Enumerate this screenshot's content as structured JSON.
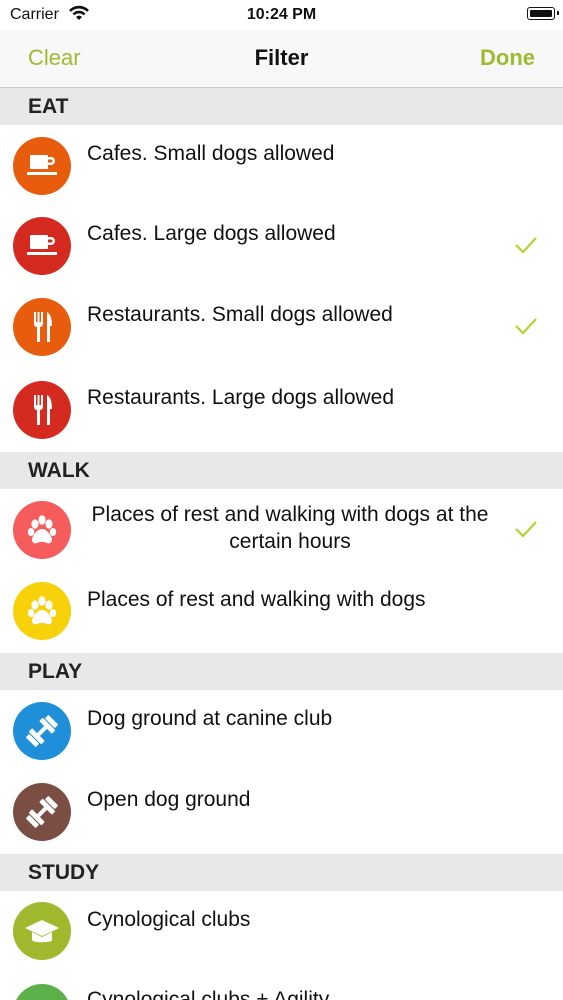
{
  "status": {
    "carrier": "Carrier",
    "time": "10:24 PM"
  },
  "nav": {
    "left": "Clear",
    "title": "Filter",
    "right": "Done"
  },
  "sections": {
    "eat": "EAT",
    "walk": "WALK",
    "play": "PLAY",
    "study": "STUDY"
  },
  "rows": {
    "cafes_small": {
      "label": "Cafes. Small dogs allowed",
      "icon": "coffee-cup-icon",
      "color": "#e85c0d",
      "checked": false
    },
    "cafes_large": {
      "label": "Cafes. Large dogs allowed",
      "icon": "coffee-cup-icon",
      "color": "#d42a1f",
      "checked": true
    },
    "rest_small": {
      "label": "Restaurants. Small dogs allowed",
      "icon": "fork-knife-icon",
      "color": "#e85c0d",
      "checked": true
    },
    "rest_large": {
      "label": "Restaurants. Large dogs allowed",
      "icon": "fork-knife-icon",
      "color": "#d42a1f",
      "checked": false
    },
    "walk_hours": {
      "label": "Places of rest and walking with dogs at the certain hours",
      "icon": "paw-icon",
      "color": "#f65c5c",
      "checked": true
    },
    "walk": {
      "label": "Places of rest and walking with dogs",
      "icon": "paw-icon",
      "color": "#f7d20a",
      "checked": false
    },
    "canine_club": {
      "label": "Dog ground at canine club",
      "icon": "dumbbell-icon",
      "color": "#1f8fd9",
      "checked": false
    },
    "open_ground": {
      "label": "Open dog ground",
      "icon": "dumbbell-icon",
      "color": "#7b4e44",
      "checked": false
    },
    "cyno_clubs": {
      "label": "Cynological clubs",
      "icon": "graduation-cap-icon",
      "color": "#a0b82e",
      "checked": false
    },
    "cyno_agility": {
      "label": "Cynological clubs + Agility",
      "icon": "graduation-cap-icon",
      "color": "#5bb04a",
      "checked": false
    }
  },
  "colors": {
    "accent": "#9dbb2e",
    "check": "#b7d132"
  }
}
